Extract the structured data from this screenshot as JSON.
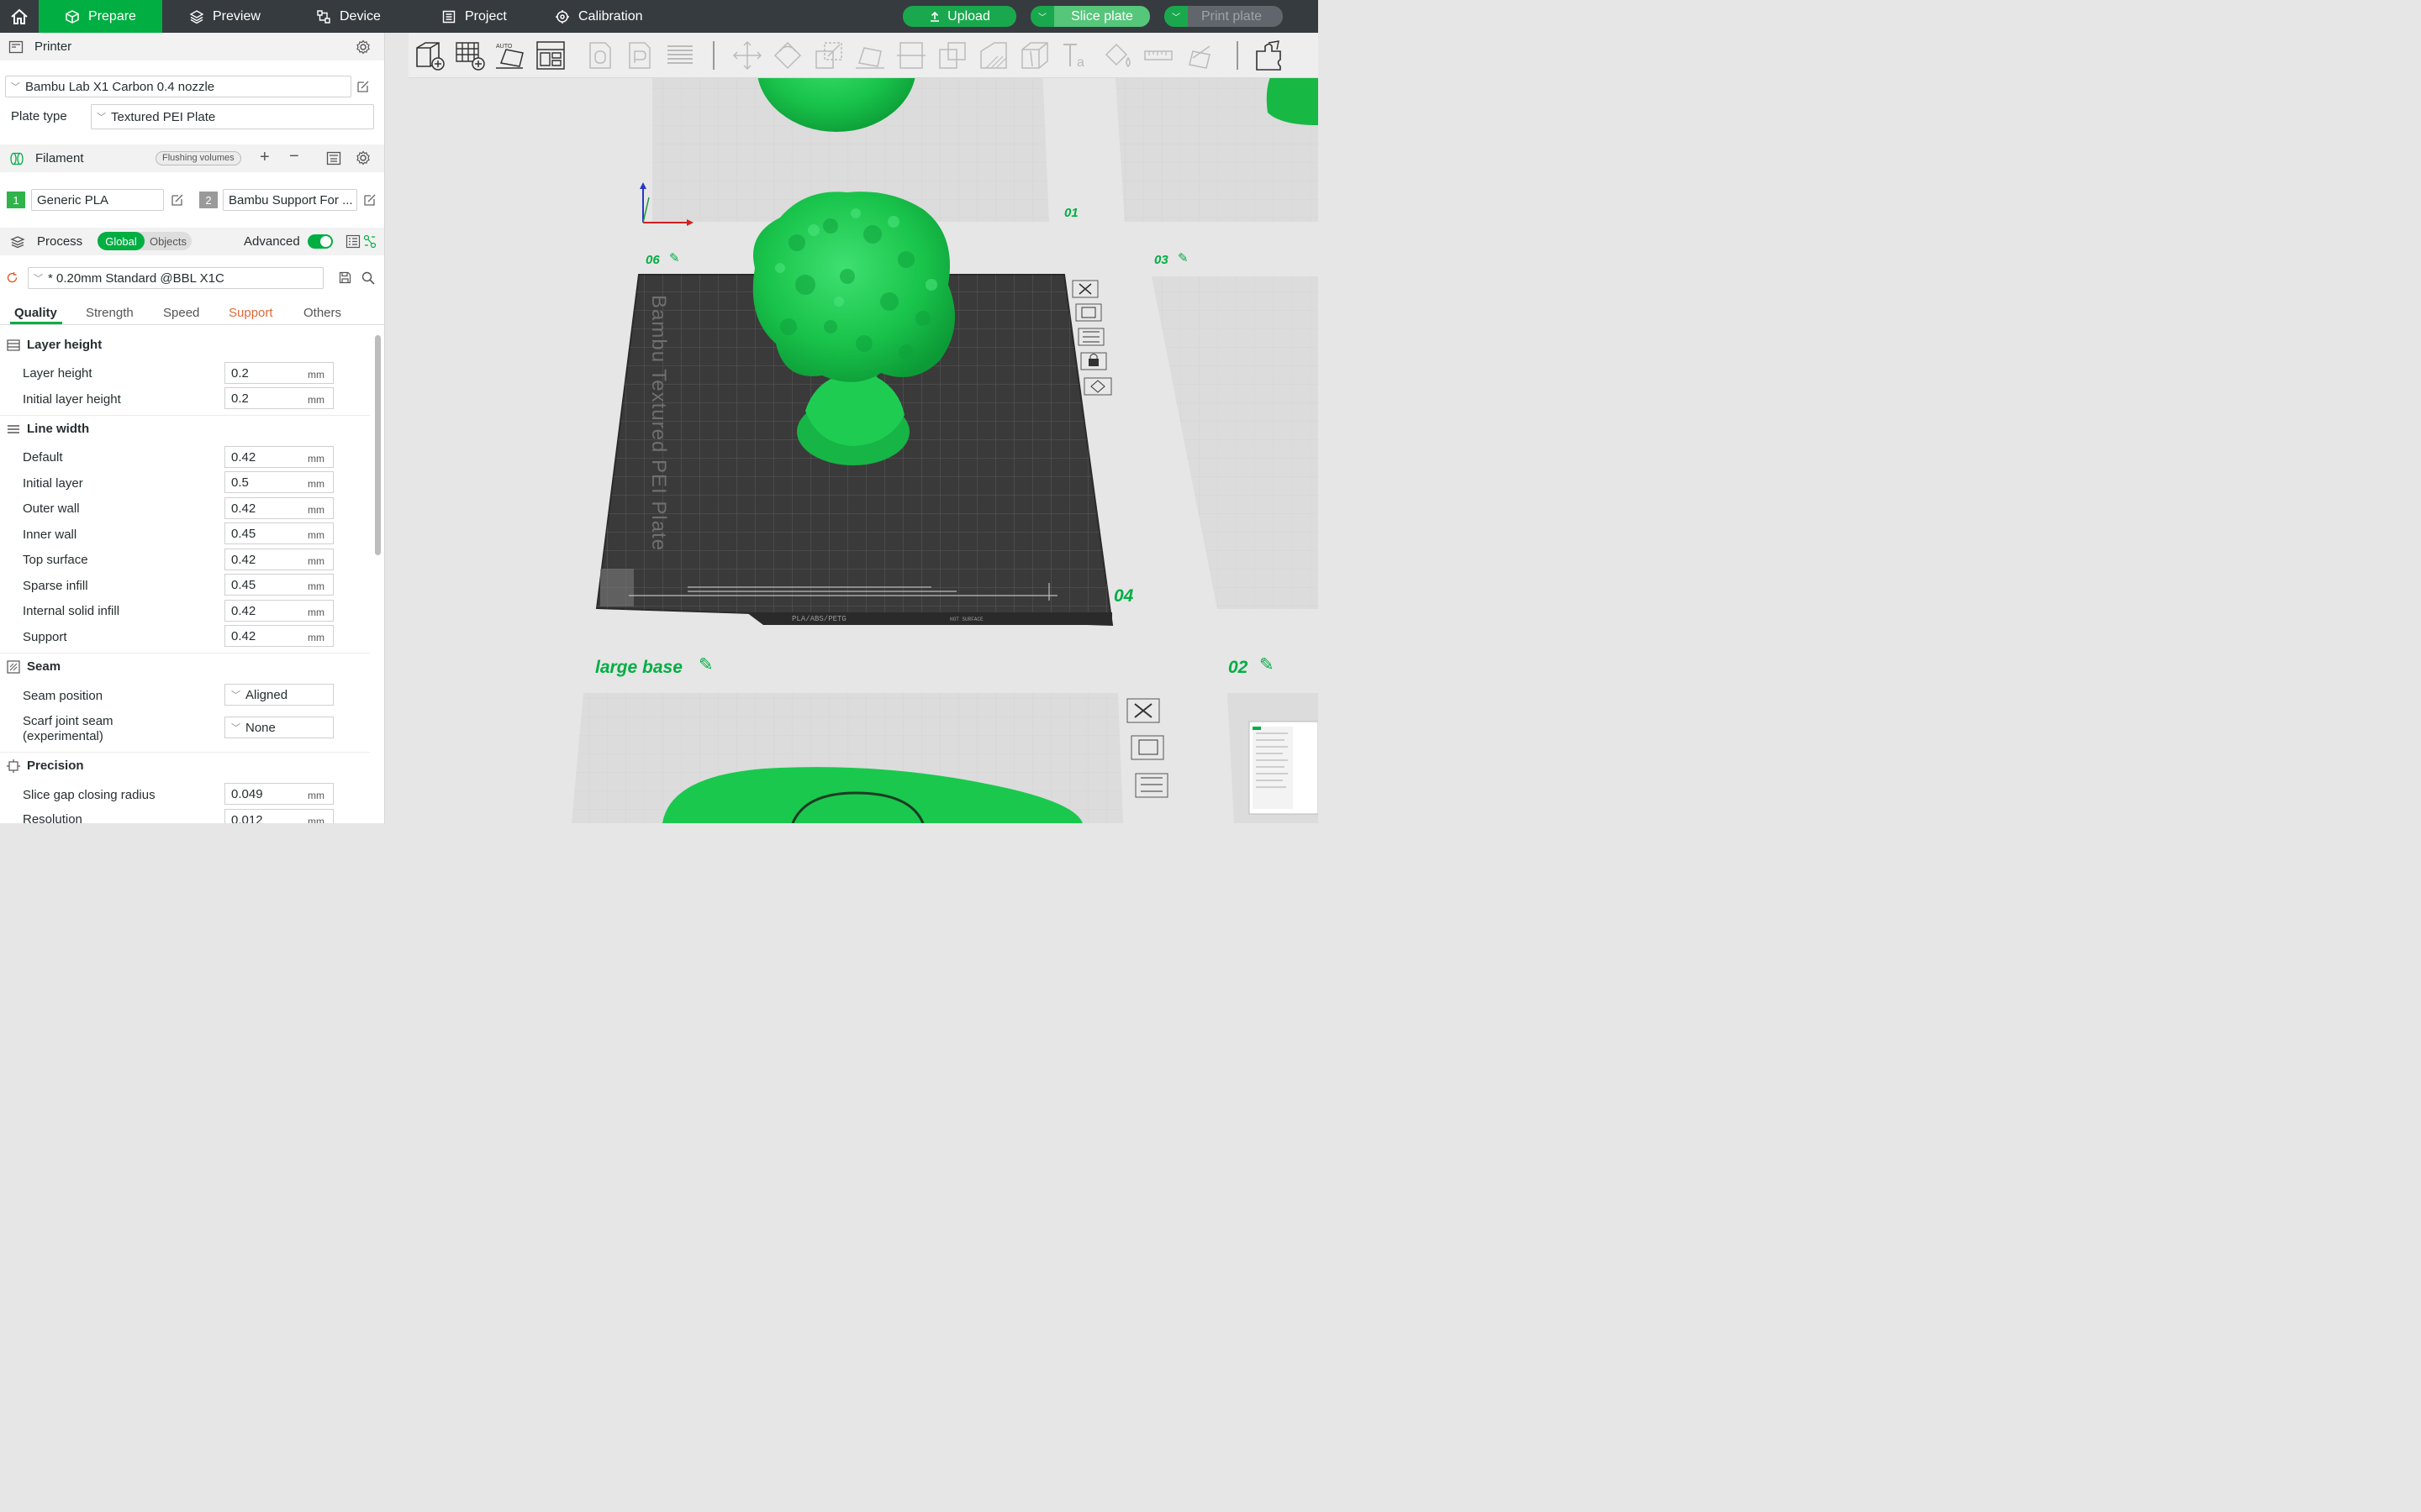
{
  "topbar": {
    "tabs": [
      {
        "label": "Prepare",
        "icon": "cube-icon"
      },
      {
        "label": "Preview",
        "icon": "layers-icon"
      },
      {
        "label": "Device",
        "icon": "device-icon"
      },
      {
        "label": "Project",
        "icon": "project-icon"
      },
      {
        "label": "Calibration",
        "icon": "calibration-icon"
      }
    ],
    "upload_label": "Upload",
    "slice_label": "Slice plate",
    "print_label": "Print plate"
  },
  "printer": {
    "section_title": "Printer",
    "selected_printer": "Bambu Lab X1 Carbon 0.4 nozzle",
    "plate_type_label": "Plate type",
    "plate_type_value": "Textured PEI Plate"
  },
  "filament": {
    "section_title": "Filament",
    "flushing_label": "Flushing volumes",
    "slots": [
      {
        "index": "1",
        "name": "Generic PLA",
        "color": "#2fb34a"
      },
      {
        "index": "2",
        "name": "Bambu Support For ...",
        "color": "#9a9a9a"
      }
    ]
  },
  "process": {
    "section_title": "Process",
    "toggle_global": "Global",
    "toggle_objects": "Objects",
    "advanced_label": "Advanced",
    "preset": "* 0.20mm Standard @BBL X1C",
    "tabs": [
      "Quality",
      "Strength",
      "Speed",
      "Support",
      "Others"
    ],
    "groups": {
      "layer_height": {
        "title": "Layer height",
        "rows": [
          {
            "label": "Layer height",
            "value": "0.2",
            "unit": "mm"
          },
          {
            "label": "Initial layer height",
            "value": "0.2",
            "unit": "mm"
          }
        ]
      },
      "line_width": {
        "title": "Line width",
        "rows": [
          {
            "label": "Default",
            "value": "0.42",
            "unit": "mm"
          },
          {
            "label": "Initial layer",
            "value": "0.5",
            "unit": "mm"
          },
          {
            "label": "Outer wall",
            "value": "0.42",
            "unit": "mm"
          },
          {
            "label": "Inner wall",
            "value": "0.45",
            "unit": "mm"
          },
          {
            "label": "Top surface",
            "value": "0.42",
            "unit": "mm"
          },
          {
            "label": "Sparse infill",
            "value": "0.45",
            "unit": "mm"
          },
          {
            "label": "Internal solid infill",
            "value": "0.42",
            "unit": "mm"
          },
          {
            "label": "Support",
            "value": "0.42",
            "unit": "mm"
          }
        ]
      },
      "seam": {
        "title": "Seam",
        "rows": [
          {
            "label": "Seam position",
            "value": "Aligned"
          },
          {
            "label_line1": "Scarf joint seam",
            "label_line2": "(experimental)",
            "value": "None"
          }
        ]
      },
      "precision": {
        "title": "Precision",
        "rows": [
          {
            "label": "Slice gap closing radius",
            "value": "0.049",
            "unit": "mm"
          },
          {
            "label": "Resolution",
            "value": "0.012",
            "unit": "mm"
          }
        ]
      }
    }
  },
  "viewport": {
    "plate_labels": {
      "p01": "01",
      "p02": "02",
      "p03": "03",
      "p04": "04",
      "p06": "06",
      "large_base": "large base"
    },
    "bed_text": "Bambu Textured PEI Plate",
    "bed_footer": "PLA/ABS/PETG",
    "bed_footer_right": "HOT SURFACE",
    "accent_color": "#00ae42"
  }
}
